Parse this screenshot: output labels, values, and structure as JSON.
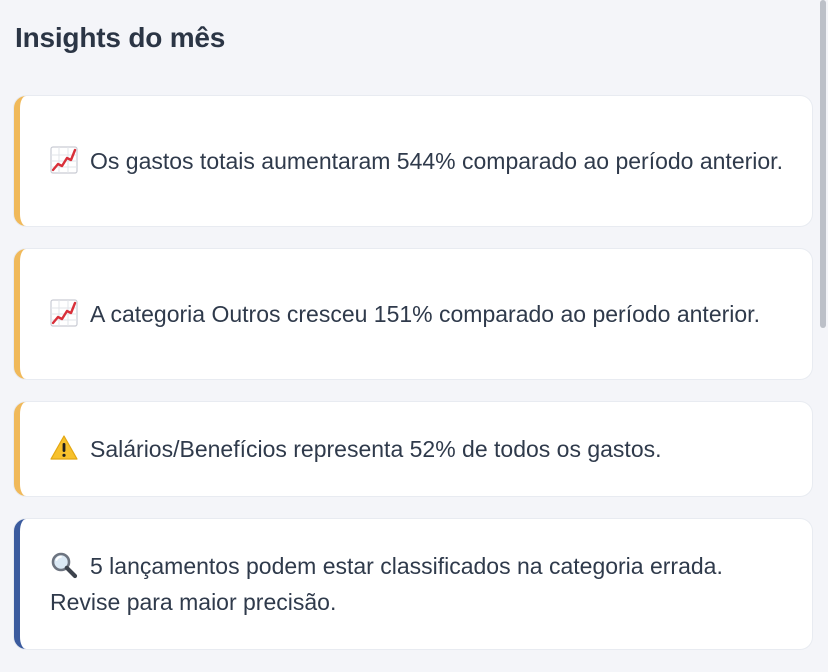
{
  "section": {
    "title": "Insights do mês"
  },
  "insights": [
    {
      "icon": "chart-increasing-icon",
      "kind": "warning",
      "text": "Os gastos totais aumentaram 544% comparado ao período anterior."
    },
    {
      "icon": "chart-increasing-icon",
      "kind": "warning",
      "text": "A categoria Outros cresceu 151% comparado ao período anterior."
    },
    {
      "icon": "warning-icon",
      "kind": "warning",
      "text": "Salários/Benefícios representa 52% de todos os gastos."
    },
    {
      "icon": "magnifier-icon",
      "kind": "info",
      "text": "5 lançamentos podem estar classificados na categoria errada. Revise para maior precisão."
    }
  ],
  "colors": {
    "background": "#f4f5f9",
    "warning_accent": "#f0b95a",
    "info_accent": "#3b5b9e",
    "text": "#2f3a4b",
    "title": "#2b3545"
  }
}
